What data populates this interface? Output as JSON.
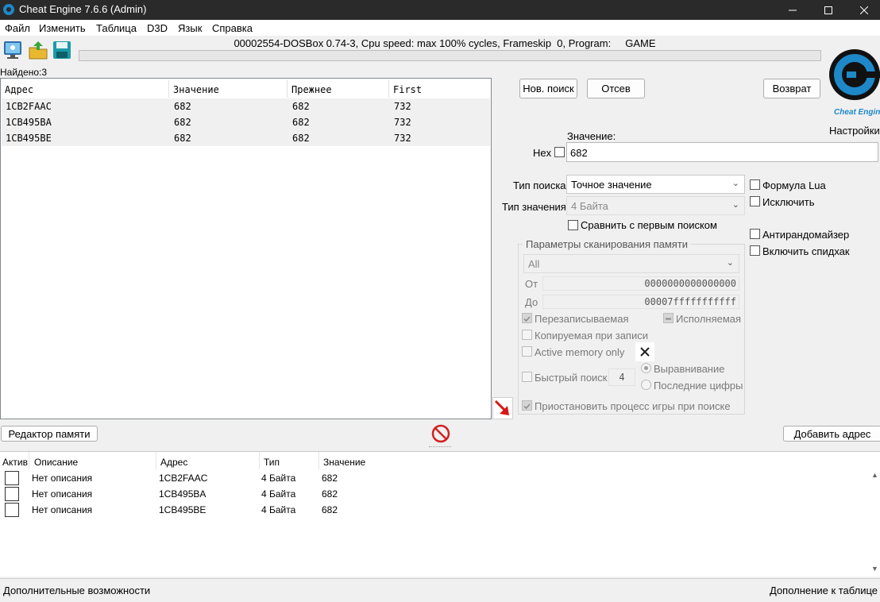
{
  "window": {
    "title": "Cheat Engine 7.6.6 (Admin)"
  },
  "menu": [
    "Файл",
    "Изменить",
    "Таблица",
    "D3D",
    "Язык",
    "Справка"
  ],
  "process_label": "00002554-DOSBox 0.74-3, Cpu speed: max 100% cycles, Frameskip  0, Program:     GAME",
  "found": "Найдено:3",
  "results": {
    "headers": [
      "Адрес",
      "Значение",
      "Прежнее",
      "First"
    ],
    "rows": [
      [
        "1CB2FAAC",
        "682",
        "682",
        "732"
      ],
      [
        "1CB495BA",
        "682",
        "682",
        "732"
      ],
      [
        "1CB495BE",
        "682",
        "682",
        "732"
      ]
    ]
  },
  "buttons": {
    "new_scan": "Нов. поиск",
    "next_scan": "Отсев",
    "undo": "Возврат",
    "memory_view": "Редактор памяти",
    "add_address": "Добавить адрес"
  },
  "settings_label": "Настройки",
  "logo_text": "Cheat Engine",
  "form": {
    "value_label": "Значение:",
    "hex_label": "Hex",
    "value": "682",
    "scan_type_label": "Тип поиска",
    "scan_type": "Точное значение",
    "value_type_label": "Тип значения",
    "value_type": "4 Байта",
    "compare_first": "Сравнить с первым поиском",
    "lua_formula": "Формула Lua",
    "not": "Исключить",
    "unrandomizer": "Антирандомайзер",
    "speedhack": "Включить спидхак"
  },
  "scan_options": {
    "title": "Параметры сканирования памяти",
    "region": "All",
    "from_label": "От",
    "from_value": "0000000000000000",
    "to_label": "До",
    "to_value": "00007fffffffffff",
    "writable": "Перезаписываемая",
    "executable": "Исполняемая",
    "copy_on_write": "Копируемая при записи",
    "active_memory": "Active memory only",
    "fast_scan": "Быстрый поиск",
    "fast_scan_value": "4",
    "alignment": "Выравнивание",
    "last_digits": "Последние цифры",
    "pause": "Приостановить процесс игры при поиске"
  },
  "address_list": {
    "headers": [
      "Актив",
      "Описание",
      "Адрес",
      "Тип",
      "Значение"
    ],
    "rows": [
      {
        "description": "Нет описания",
        "address": "1CB2FAAC",
        "type": "4 Байта",
        "value": "682"
      },
      {
        "description": "Нет описания",
        "address": "1CB495BA",
        "type": "4 Байта",
        "value": "682"
      },
      {
        "description": "Нет описания",
        "address": "1CB495BE",
        "type": "4 Байта",
        "value": "682"
      }
    ]
  },
  "status": {
    "left": "Дополнительные возможности",
    "right": "Дополнение к таблице"
  },
  "colors": {
    "titlebar": "#2a2a2a",
    "accent": "#1e88c8",
    "arrow": "#d81818",
    "stop": "#d32020"
  }
}
